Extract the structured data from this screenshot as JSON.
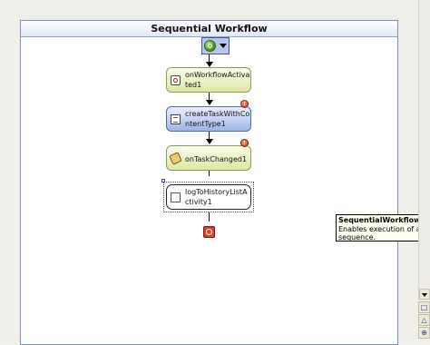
{
  "designer": {
    "title": "Sequential Workflow",
    "start_menu_icon": "play-circle-icon",
    "activities": [
      {
        "label": "onWorkflowActivated1",
        "icon": "event-icon",
        "has_error": false
      },
      {
        "label": "createTaskWithContentType1",
        "icon": "task-icon",
        "has_error": true
      },
      {
        "label": "onTaskChanged1",
        "icon": "task-changed-icon",
        "has_error": true
      },
      {
        "label": "logToHistoryListActivity1",
        "icon": "log-icon",
        "has_error": false,
        "selected": true
      }
    ],
    "end_icon": "stop-icon"
  },
  "tooltip": {
    "title": "SequentialWorkflowActiv",
    "description": "Enables execution of a group sequence."
  },
  "colors": {
    "canvas_border": "#7a8fb8",
    "green_activity": "#dbe8a4",
    "blue_activity": "#9fb4e8",
    "error_badge": "#d1290d"
  }
}
